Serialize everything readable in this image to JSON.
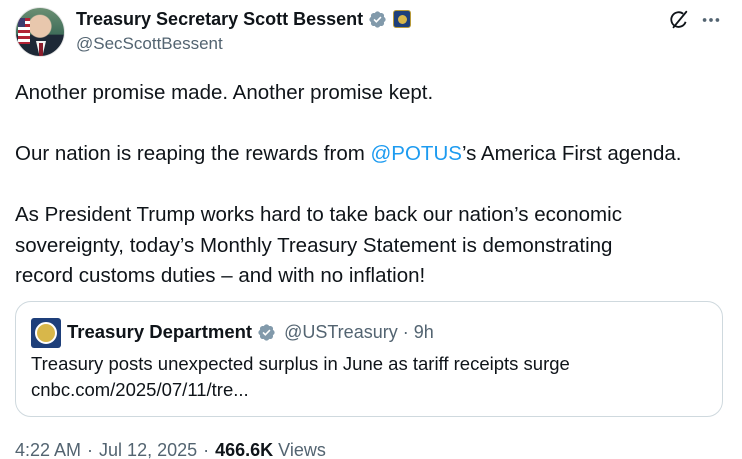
{
  "author": {
    "name": "Treasury Secretary Scott Bessent",
    "handle": "@SecScottBessent"
  },
  "icons": [
    "verified-badge-icon",
    "government-affiliation-icon",
    "grok-icon",
    "more-icon"
  ],
  "text": {
    "line1": "Another promise made. Another promise kept.",
    "line2_before": "Our nation is reaping the rewards from ",
    "line2_mention": "@POTUS",
    "line2_after": "’s America First agenda.",
    "line3": "As President Trump works hard to take back our nation’s economic",
    "line4": "sovereignty, today’s Monthly Treasury Statement is demonstrating",
    "line5": "record customs duties – and with no inflation!"
  },
  "quote": {
    "name": "Treasury Department",
    "handle": "@USTreasury",
    "separator": "·",
    "time": "9h",
    "headline": "Treasury posts unexpected surplus in June as tariff receipts surge",
    "link": "cnbc.com/2025/07/11/tre..."
  },
  "meta": {
    "time": "4:22 AM",
    "separator": "·",
    "date": "Jul 12, 2025",
    "views_count": "466.6K",
    "views_label": "Views"
  },
  "colors": {
    "link": "#1d9bf0",
    "verified": "#829aab",
    "secondary_text": "#536471",
    "primary_text": "#0f1419",
    "border": "#cfd9de"
  }
}
